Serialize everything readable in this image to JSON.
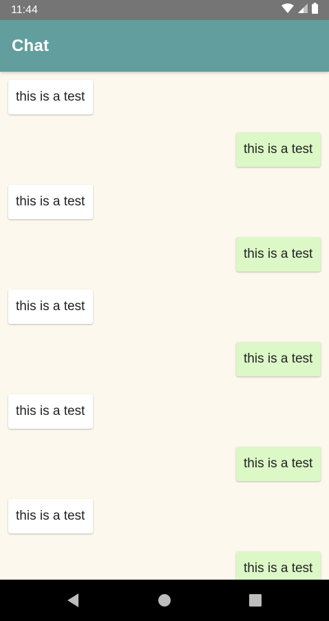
{
  "status_bar": {
    "time": "11:44",
    "icons": [
      "wifi-icon",
      "cell-signal-icon",
      "battery-icon"
    ]
  },
  "app_bar": {
    "title": "Chat",
    "color": "#629e9e"
  },
  "messages": [
    {
      "direction": "incoming",
      "text": "this is a test"
    },
    {
      "direction": "outgoing",
      "text": "this is a test"
    },
    {
      "direction": "incoming",
      "text": "this is a test"
    },
    {
      "direction": "outgoing",
      "text": "this is a test"
    },
    {
      "direction": "incoming",
      "text": "this is a test"
    },
    {
      "direction": "outgoing",
      "text": "this is a test"
    },
    {
      "direction": "incoming",
      "text": "this is a test"
    },
    {
      "direction": "outgoing",
      "text": "this is a test"
    },
    {
      "direction": "incoming",
      "text": "this is a test"
    },
    {
      "direction": "outgoing",
      "text": "this is a test"
    }
  ],
  "colors": {
    "background": "#fcf8ed",
    "incoming_bubble": "#ffffff",
    "outgoing_bubble": "#dcf8c6"
  },
  "nav_bar": {
    "buttons": [
      "back-icon",
      "home-icon",
      "recents-icon"
    ]
  }
}
